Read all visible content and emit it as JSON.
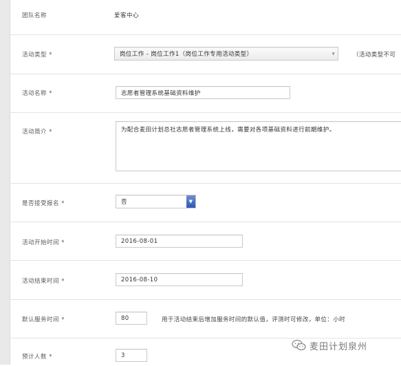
{
  "form": {
    "team_name": {
      "label": "团队名称",
      "value": "爱客中心"
    },
    "activity_type": {
      "label": "活动类型 *",
      "selected": "岗位工作 - 岗位工作1（岗位工作专用活动类型）",
      "note": "（活动类型不可"
    },
    "activity_name": {
      "label": "活动名称 *",
      "value": "志愿者管理系统基础资料维护"
    },
    "activity_intro": {
      "label": "活动简介 *",
      "value": "为配合麦田计划总社志愿者管理系统上线，需要对各项基础资料进行前期维护。"
    },
    "accept_signup": {
      "label": "是否接受报名 *",
      "selected": "否"
    },
    "start_time": {
      "label": "活动开始时间 *",
      "value": "2016-08-01"
    },
    "end_time": {
      "label": "活动结束时间 *",
      "value": "2016-08-10"
    },
    "default_service_time": {
      "label": "默认服务时间 *",
      "value": "80",
      "note": "用于活动结束后增加服务时间的默认值，评测时可修改，单位：小时"
    },
    "expected_people": {
      "label": "预计人数 *",
      "value": "3"
    }
  },
  "watermark": {
    "text": "麦田计划泉州",
    "icon": "wechat-icon"
  }
}
